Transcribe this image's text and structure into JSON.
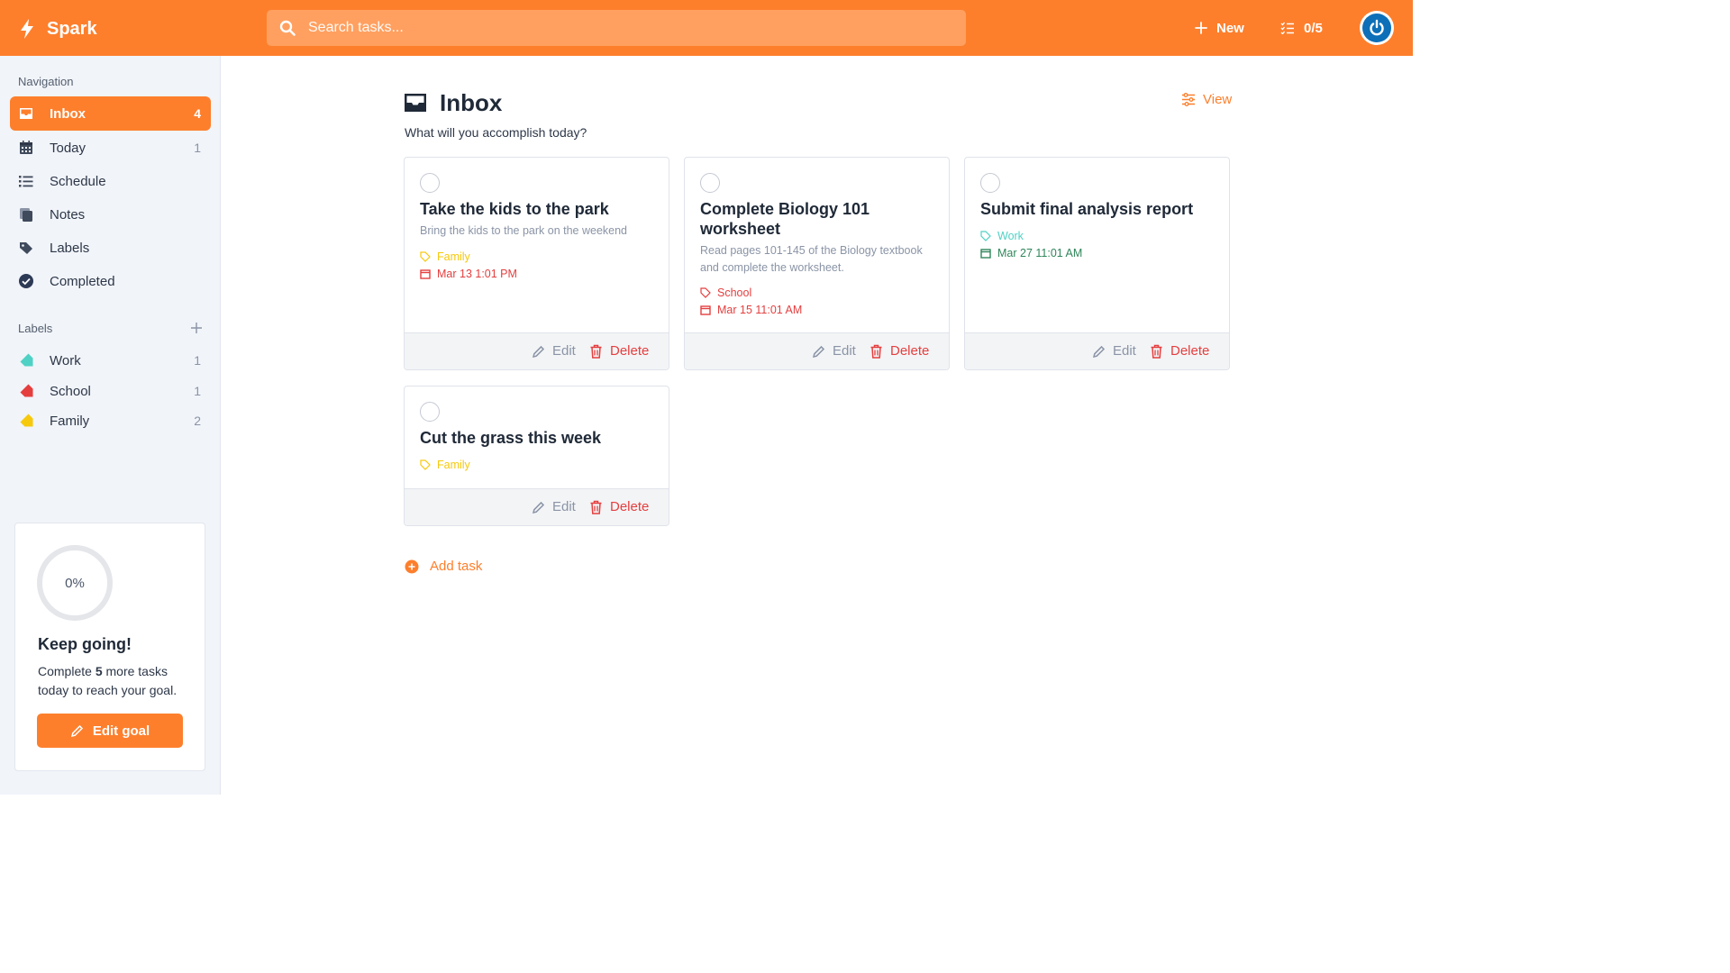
{
  "app": {
    "name": "Spark"
  },
  "search": {
    "placeholder": "Search tasks..."
  },
  "topbar": {
    "new_label": "New",
    "progress": "0/5"
  },
  "sidebar": {
    "navigation_title": "Navigation",
    "nav": [
      {
        "label": "Inbox",
        "count": "4",
        "icon": "inbox-icon"
      },
      {
        "label": "Today",
        "count": "1",
        "icon": "calendar-icon"
      },
      {
        "label": "Schedule",
        "count": "",
        "icon": "list-icon"
      },
      {
        "label": "Notes",
        "count": "",
        "icon": "notes-icon"
      },
      {
        "label": "Labels",
        "count": "",
        "icon": "tags-icon"
      },
      {
        "label": "Completed",
        "count": "",
        "icon": "check-circle-icon"
      }
    ],
    "labels_title": "Labels",
    "labels": [
      {
        "label": "Work",
        "count": "1",
        "color": "#4fd1c5"
      },
      {
        "label": "School",
        "count": "1",
        "color": "#e53e3e"
      },
      {
        "label": "Family",
        "count": "2",
        "color": "#f6c90e"
      }
    ],
    "goal": {
      "percent": "0%",
      "title": "Keep going!",
      "text_before": "Complete ",
      "count": "5",
      "text_after": " more tasks today to reach your goal.",
      "button": "Edit goal"
    }
  },
  "main": {
    "title": "Inbox",
    "subtitle": "What will you accomplish today?",
    "view_label": "View",
    "add_task": "Add task",
    "edit_label": "Edit",
    "delete_label": "Delete",
    "tasks": [
      {
        "title": "Take the kids to the park",
        "description": "Bring the kids to the park on the weekend",
        "label": "Family",
        "label_color": "#f6c90e",
        "date": "Mar 13 1:01 PM",
        "date_color": "#e53e3e"
      },
      {
        "title": "Complete Biology 101 worksheet",
        "description": "Read pages 101-145 of the Biology textbook and complete the worksheet.",
        "label": "School",
        "label_color": "#e53e3e",
        "date": "Mar 15 11:01 AM",
        "date_color": "#e53e3e"
      },
      {
        "title": "Submit final analysis report",
        "description": "",
        "label": "Work",
        "label_color": "#4fd1c5",
        "date": "Mar 27 11:01 AM",
        "date_color": "#2f855a"
      },
      {
        "title": "Cut the grass this week",
        "description": "",
        "label": "Family",
        "label_color": "#f6c90e",
        "date": "",
        "date_color": ""
      }
    ]
  },
  "colors": {
    "accent": "#fd7f2c",
    "sidebar_bg": "#f1f4f9",
    "danger": "#e53e3e"
  }
}
